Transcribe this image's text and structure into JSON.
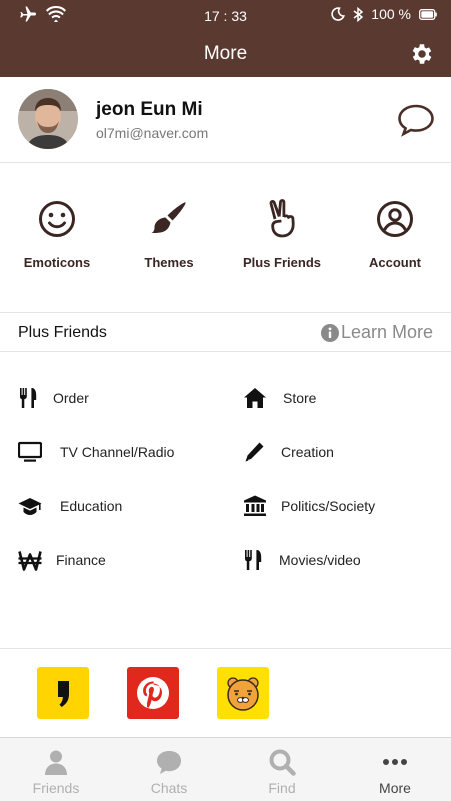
{
  "status_bar": {
    "time": "17 : 33",
    "battery": "100 %"
  },
  "header": {
    "title": "More"
  },
  "profile": {
    "name": "jeon Eun Mi",
    "email": "ol7mi@naver.com"
  },
  "quick_actions": [
    {
      "label": "Emoticons",
      "icon": "smiley-icon"
    },
    {
      "label": "Themes",
      "icon": "paintbrush-icon"
    },
    {
      "label": "Plus Friends",
      "icon": "peace-hand-icon"
    },
    {
      "label": "Account",
      "icon": "user-circle-icon"
    }
  ],
  "plus_friends": {
    "title": "Plus Friends",
    "learn_more": "Learn More",
    "categories": [
      {
        "label": "Order",
        "icon": "utensils-icon"
      },
      {
        "label": "Store",
        "icon": "home-icon"
      },
      {
        "label": "TV Channel/Radio",
        "icon": "monitor-icon"
      },
      {
        "label": "Creation",
        "icon": "pencil-icon"
      },
      {
        "label": "Education",
        "icon": "graduation-cap-icon"
      },
      {
        "label": "Politics/Society",
        "icon": "institution-icon"
      },
      {
        "label": "Finance",
        "icon": "won-icon"
      },
      {
        "label": "Movies/video",
        "icon": "utensils-icon"
      }
    ]
  },
  "apps": [
    {
      "name": "kakaopage-icon",
      "color": "#ffd400"
    },
    {
      "name": "pinterest-icon",
      "color": "#e0281c"
    },
    {
      "name": "kakao-ryan-icon",
      "color": "#ffe000"
    }
  ],
  "tabs": [
    {
      "label": "Friends",
      "icon": "person-icon"
    },
    {
      "label": "Chats",
      "icon": "chat-icon"
    },
    {
      "label": "Find",
      "icon": "search-icon"
    },
    {
      "label": "More",
      "icon": "more-dots-icon"
    }
  ],
  "colors": {
    "header_bg": "#5a3a30",
    "icon_brown": "#3a2622"
  }
}
